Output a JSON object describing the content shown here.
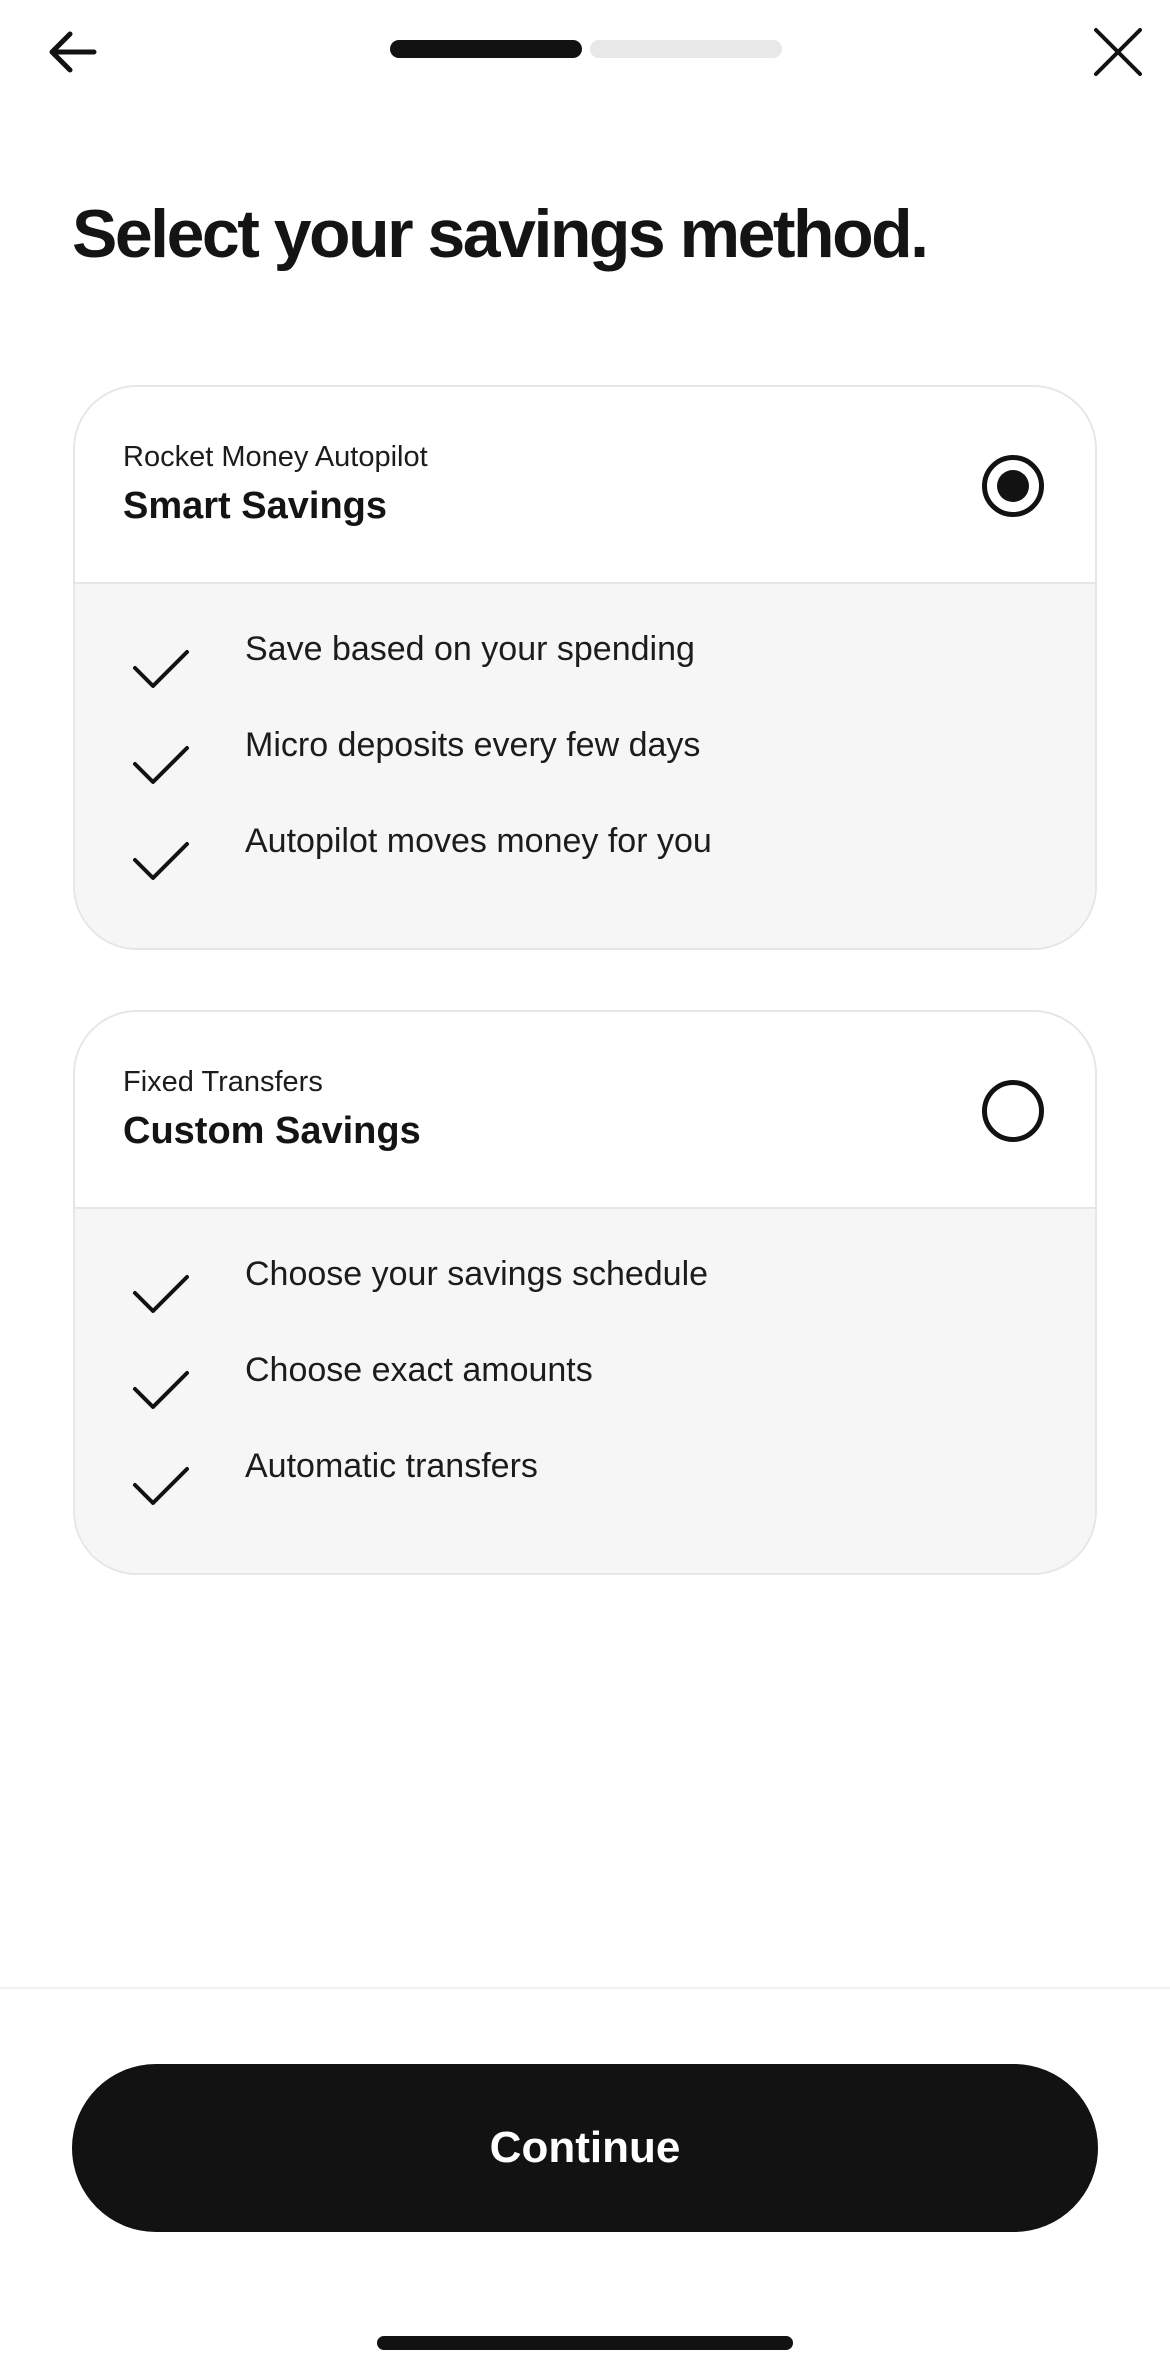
{
  "header": {
    "back_icon": "arrow-left-icon",
    "close_icon": "close-icon",
    "progress": {
      "completed_steps": 1,
      "total_steps": 2
    }
  },
  "title": "Select your savings method.",
  "options": [
    {
      "kicker": "Rocket Money Autopilot",
      "name": "Smart Savings",
      "selected": true,
      "features": [
        "Save based on your spending",
        "Micro deposits every few days",
        "Autopilot moves money for you"
      ]
    },
    {
      "kicker": "Fixed Transfers",
      "name": "Custom Savings",
      "selected": false,
      "features": [
        "Choose your savings schedule",
        "Choose exact amounts",
        "Automatic transfers"
      ]
    }
  ],
  "footer": {
    "continue_label": "Continue"
  },
  "colors": {
    "primary": "#121212",
    "card_border": "#e6e6e6",
    "card_body": "#f6f6f6",
    "progress_track": "#e8e8e8"
  }
}
